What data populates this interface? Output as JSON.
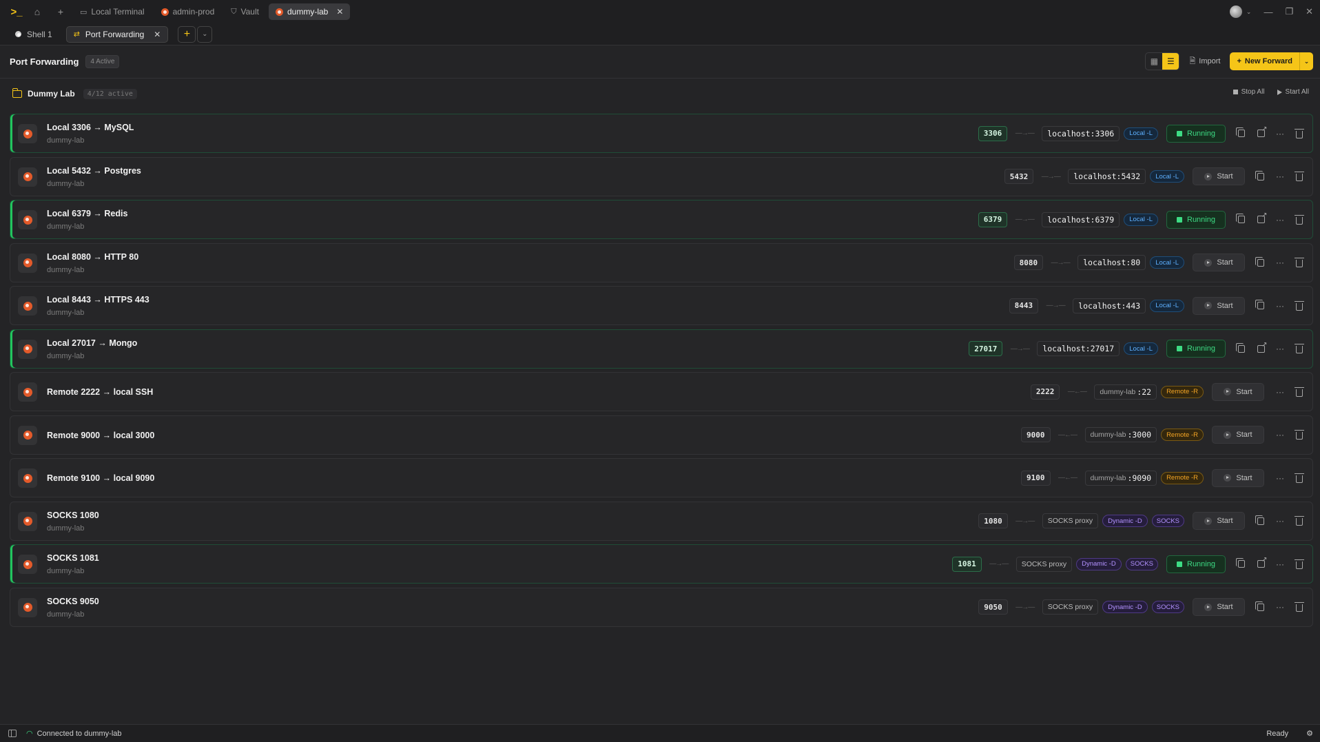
{
  "titlebar": {
    "tabs": [
      {
        "label": "Local Terminal",
        "icon": "monitor-icon",
        "active": false
      },
      {
        "label": "admin-prod",
        "icon": "ubuntu-icon",
        "active": false
      },
      {
        "label": "Vault",
        "icon": "shield-icon",
        "active": false
      },
      {
        "label": "dummy-lab",
        "icon": "ubuntu-icon",
        "active": true
      }
    ]
  },
  "subtabs": {
    "items": [
      {
        "label": "Shell 1",
        "active": false
      },
      {
        "label": "Port Forwarding",
        "active": true
      }
    ]
  },
  "header": {
    "title": "Port Forwarding",
    "active_badge": "4 Active",
    "import_label": "Import",
    "new_forward_label": "New Forward"
  },
  "group": {
    "name": "Dummy Lab",
    "count": "4/12 active",
    "stop_all_label": "Stop All",
    "start_all_label": "Start All"
  },
  "rows": [
    {
      "title": "Local 3306 → MySQL",
      "subtitle": "dummy-lab",
      "src": "3306",
      "arrow": "—→—",
      "dest_host": "",
      "dest": "localhost:3306",
      "type": "Local -L",
      "type_kind": "local",
      "socks": "",
      "status": "Running"
    },
    {
      "title": "Local 5432 → Postgres",
      "subtitle": "dummy-lab",
      "src": "5432",
      "arrow": "—→—",
      "dest_host": "",
      "dest": "localhost:5432",
      "type": "Local -L",
      "type_kind": "local",
      "socks": "",
      "status": "Start"
    },
    {
      "title": "Local 6379 → Redis",
      "subtitle": "dummy-lab",
      "src": "6379",
      "arrow": "—→—",
      "dest_host": "",
      "dest": "localhost:6379",
      "type": "Local -L",
      "type_kind": "local",
      "socks": "",
      "status": "Running"
    },
    {
      "title": "Local 8080 → HTTP 80",
      "subtitle": "dummy-lab",
      "src": "8080",
      "arrow": "—→—",
      "dest_host": "",
      "dest": "localhost:80",
      "type": "Local -L",
      "type_kind": "local",
      "socks": "",
      "status": "Start"
    },
    {
      "title": "Local 8443 → HTTPS 443",
      "subtitle": "dummy-lab",
      "src": "8443",
      "arrow": "—→—",
      "dest_host": "",
      "dest": "localhost:443",
      "type": "Local -L",
      "type_kind": "local",
      "socks": "",
      "status": "Start"
    },
    {
      "title": "Local 27017 → Mongo",
      "subtitle": "dummy-lab",
      "src": "27017",
      "arrow": "—→—",
      "dest_host": "",
      "dest": "localhost:27017",
      "type": "Local -L",
      "type_kind": "local",
      "socks": "",
      "status": "Running"
    },
    {
      "title": "Remote 2222 → local SSH",
      "subtitle": "",
      "src": "2222",
      "arrow": "—←—",
      "dest_host": "dummy-lab",
      "dest": ":22",
      "type": "Remote -R",
      "type_kind": "remote",
      "socks": "",
      "status": "Start"
    },
    {
      "title": "Remote 9000 → local 3000",
      "subtitle": "",
      "src": "9000",
      "arrow": "—←—",
      "dest_host": "dummy-lab",
      "dest": ":3000",
      "type": "Remote -R",
      "type_kind": "remote",
      "socks": "",
      "status": "Start"
    },
    {
      "title": "Remote 9100 → local 9090",
      "subtitle": "",
      "src": "9100",
      "arrow": "—←—",
      "dest_host": "dummy-lab",
      "dest": ":9090",
      "type": "Remote -R",
      "type_kind": "remote",
      "socks": "",
      "status": "Start"
    },
    {
      "title": "SOCKS 1080",
      "subtitle": "dummy-lab",
      "src": "1080",
      "arrow": "—→—",
      "dest_host": "",
      "dest": "SOCKS proxy",
      "type": "Dynamic -D",
      "type_kind": "dynamic",
      "socks": "SOCKS",
      "status": "Start"
    },
    {
      "title": "SOCKS 1081",
      "subtitle": "dummy-lab",
      "src": "1081",
      "arrow": "—→—",
      "dest_host": "",
      "dest": "SOCKS proxy",
      "type": "Dynamic -D",
      "type_kind": "dynamic",
      "socks": "SOCKS",
      "status": "Running"
    },
    {
      "title": "SOCKS 9050",
      "subtitle": "dummy-lab",
      "src": "9050",
      "arrow": "—→—",
      "dest_host": "",
      "dest": "SOCKS proxy",
      "type": "Dynamic -D",
      "type_kind": "dynamic",
      "socks": "SOCKS",
      "status": "Start"
    }
  ],
  "statusbar": {
    "connection": "Connected to dummy-lab",
    "state": "Ready"
  },
  "colors": {
    "accent": "#f5c518",
    "running": "#3ddc84",
    "local": "#5eb0ff",
    "remote": "#f5a524",
    "dynamic": "#b392ff"
  }
}
